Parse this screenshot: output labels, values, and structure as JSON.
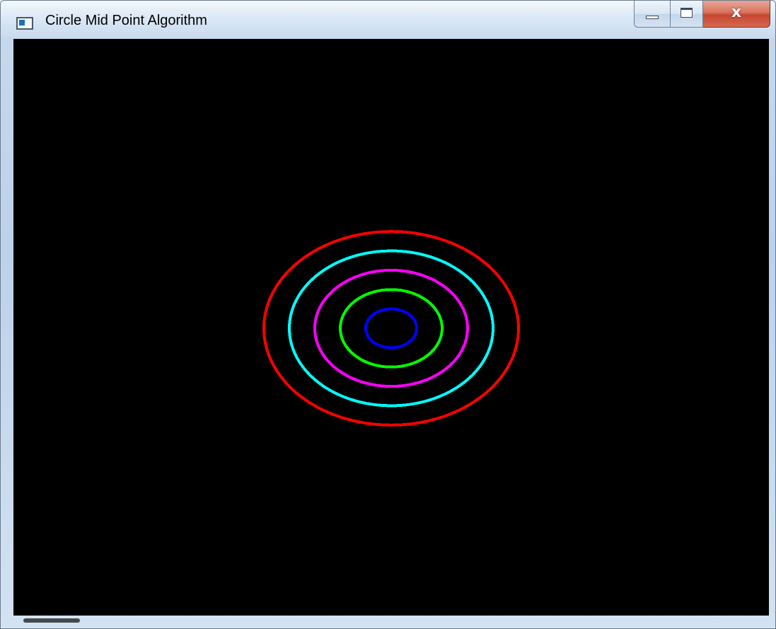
{
  "window": {
    "title": "Circle Mid Point Algorithm",
    "icon": "app-window-icon",
    "caption_buttons": {
      "minimize_icon": "minimize-icon",
      "maximize_icon": "maximize-icon",
      "close_glyph": "x"
    }
  },
  "canvas": {
    "background": "#000000",
    "circles": [
      {
        "color": "#ff0000",
        "radius": 180
      },
      {
        "color": "#00ffff",
        "radius": 144
      },
      {
        "color": "#ff00ff",
        "radius": 108
      },
      {
        "color": "#00ff00",
        "radius": 72
      },
      {
        "color": "#0000ff",
        "radius": 36
      }
    ]
  }
}
